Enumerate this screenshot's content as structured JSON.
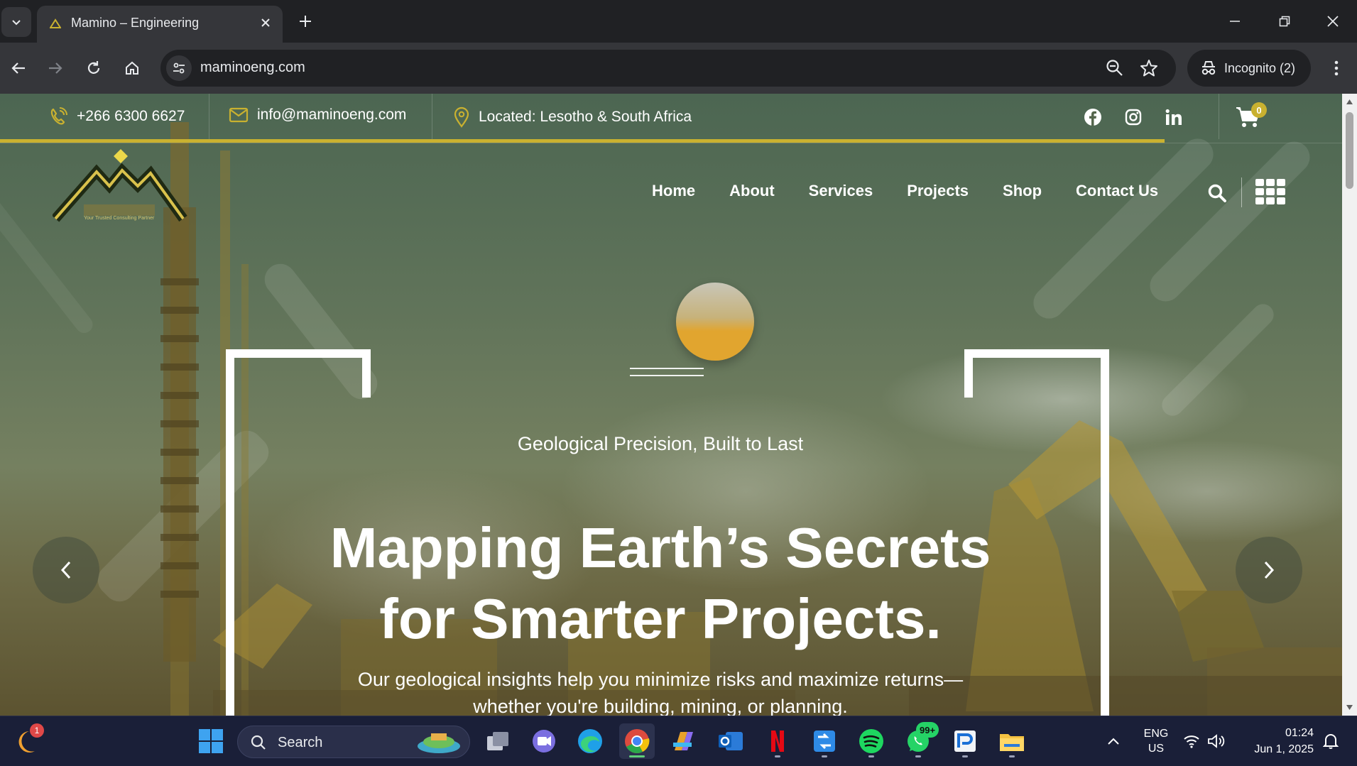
{
  "browser": {
    "tab": {
      "title": "Mamino – Engineering"
    },
    "address_bar": {
      "url": "maminoeng.com"
    },
    "incognito_label": "Incognito (2)"
  },
  "site": {
    "topbar": {
      "phone": "+266 6300 6627",
      "email": "info@maminoeng.com",
      "location": "Located: Lesotho & South Africa",
      "cart_count": "0",
      "social_icons": [
        "facebook-icon",
        "instagram-icon",
        "linkedin-icon"
      ]
    },
    "logo": {
      "tagline": "Your Trusted Consulting Partner"
    },
    "nav": [
      "Home",
      "About",
      "Services",
      "Projects",
      "Shop",
      "Contact Us"
    ],
    "hero": {
      "tagline": "Geological Precision, Built to Last",
      "headline_line1": "Mapping Earth’s Secrets",
      "headline_line2": "for Smarter Projects.",
      "subcopy_line1": "Our geological insights help you minimize risks and maximize returns—",
      "subcopy_line2": "whether you're building, mining, or planning."
    },
    "colors": {
      "accent": "#c9b130",
      "sun": "#e1a52f"
    }
  },
  "taskbar": {
    "search_label": "Search",
    "weather_badge": "1",
    "whatsapp_badge": "99+",
    "language": "ENG",
    "region": "US",
    "time": "01:24",
    "date": "Jun 1, 2025"
  }
}
